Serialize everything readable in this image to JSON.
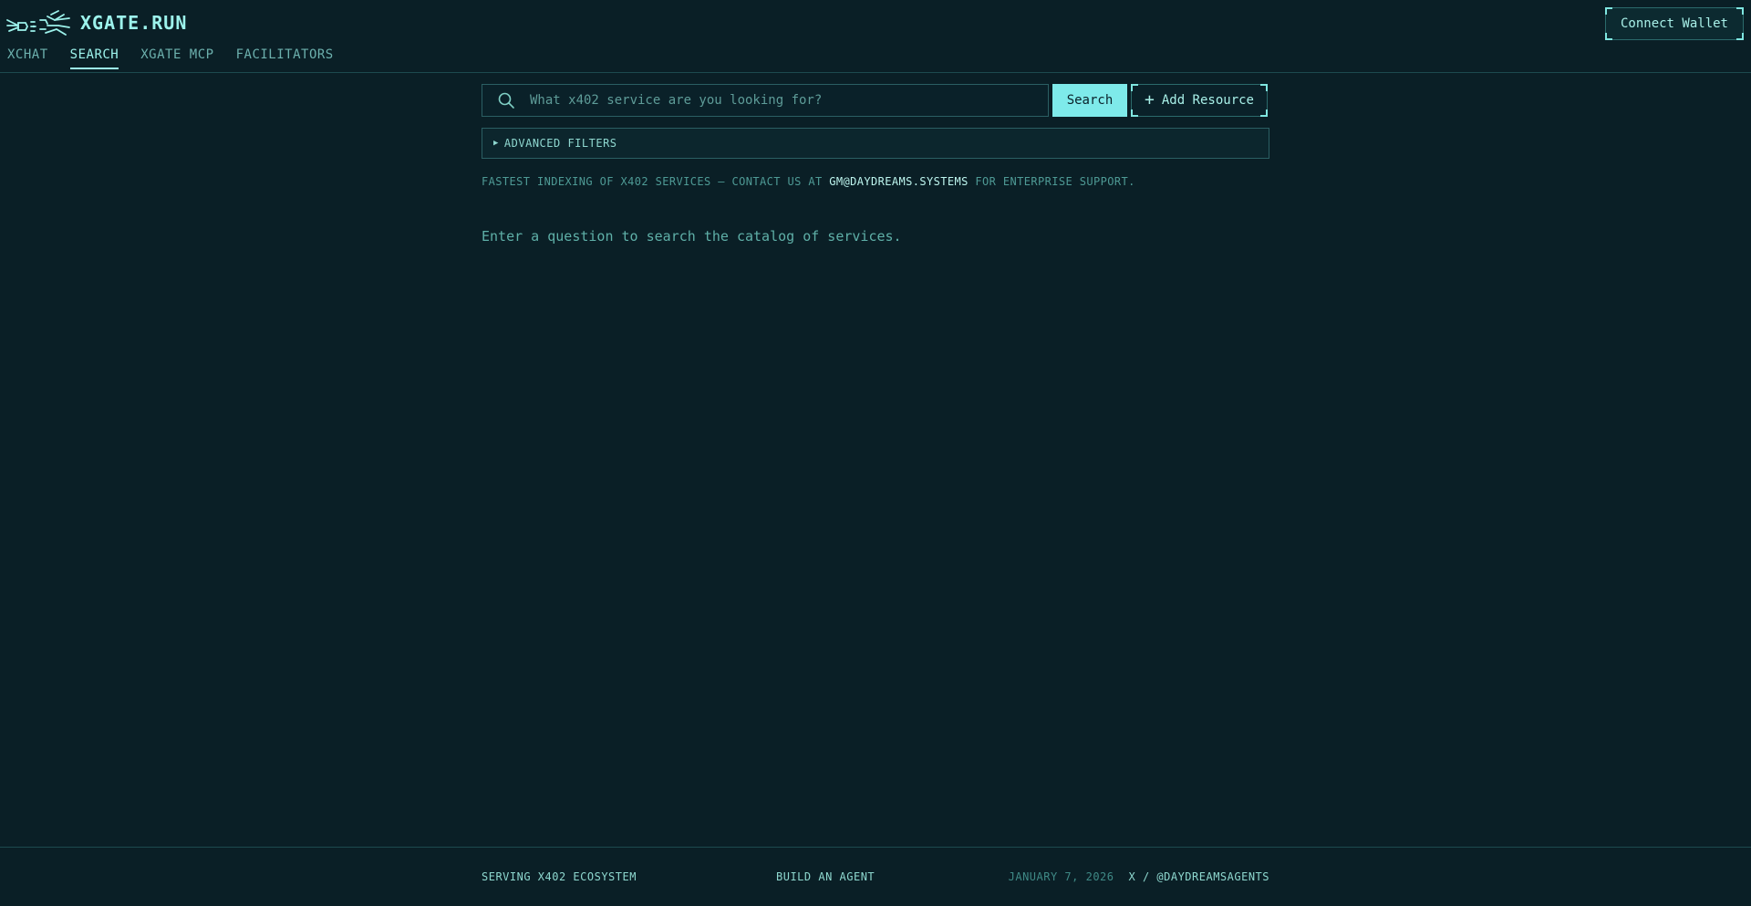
{
  "app": {
    "title": "XGATE.RUN"
  },
  "nav": {
    "items": [
      {
        "label": "XCHAT",
        "active": false
      },
      {
        "label": "SEARCH",
        "active": true
      },
      {
        "label": "XGATE MCP",
        "active": false
      },
      {
        "label": "FACILITATORS",
        "active": false
      }
    ]
  },
  "header": {
    "connect_label": "Connect Wallet"
  },
  "search": {
    "placeholder": "What x402 service are you looking for?",
    "value": "",
    "button_label": "Search",
    "add_label": "Add Resource"
  },
  "filters": {
    "label": "ADVANCED FILTERS"
  },
  "notice": {
    "prefix": "FASTEST INDEXING OF X402 SERVICES — CONTACT US AT ",
    "email": "GM@DAYDREAMS.SYSTEMS",
    "suffix": " FOR ENTERPRISE SUPPORT."
  },
  "empty": {
    "message": "Enter a question to search the catalog of services."
  },
  "footer": {
    "left": "SERVING X402 ECOSYSTEM",
    "middle": "BUILD AN AGENT",
    "date": "JANUARY 7, 2026",
    "social": "X / @DAYDREAMSAGENTS"
  },
  "colors": {
    "background": "#0a1f26",
    "accent": "#7eeaea",
    "text": "#7fcfc4"
  }
}
